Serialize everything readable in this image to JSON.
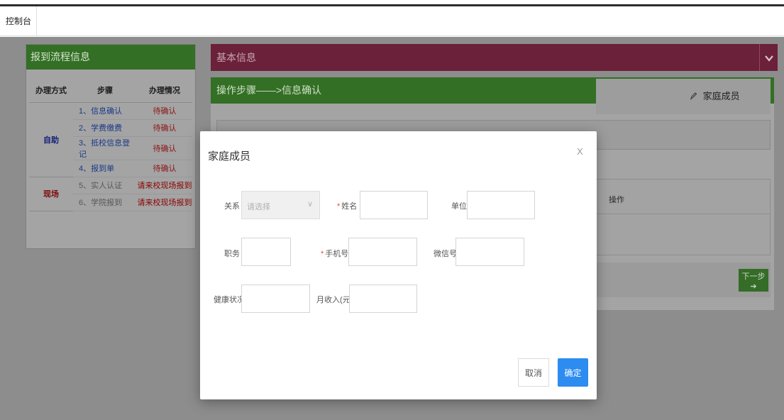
{
  "tabs": [
    {
      "label": "控制台"
    }
  ],
  "left_panel": {
    "title": "报到流程信息",
    "columns": [
      "办理方式",
      "步骤",
      "办理情况"
    ],
    "groups": [
      {
        "mode": "自助",
        "rows": [
          {
            "step": "1、信息确认",
            "status": "待确认"
          },
          {
            "step": "2、学费缴费",
            "status": "待确认"
          },
          {
            "step": "3、抵校信息登记",
            "status": "待确认"
          },
          {
            "step": "4、报到单",
            "status": "待确认"
          }
        ]
      },
      {
        "mode": "现场",
        "rows": [
          {
            "step": "5、实人认证",
            "status": "请来校现场报到"
          },
          {
            "step": "6、学院报到",
            "status": "请来校现场报到"
          }
        ]
      }
    ]
  },
  "basic_info": {
    "title": "基本信息",
    "collapse_icon": "chevron-down-icon"
  },
  "steps_panel": {
    "title": "操作步骤——>信息确认",
    "current_step": "家庭成员",
    "current_step_icon": "pencil-icon",
    "ops_header": "操作",
    "next_button": "下一步"
  },
  "modal": {
    "title": "家庭成员",
    "close": "X",
    "fields": {
      "relation": {
        "label": "关系",
        "placeholder": "请选择"
      },
      "name": {
        "label": "姓名",
        "required": "*"
      },
      "unit": {
        "label": "单位"
      },
      "position": {
        "label": "职务"
      },
      "phone": {
        "label": "手机号",
        "required": "*"
      },
      "wechat": {
        "label": "微信号"
      },
      "health": {
        "label": "健康状况"
      },
      "income": {
        "label": "月收入(元)"
      }
    },
    "cancel": "取消",
    "confirm": "确定"
  },
  "colors": {
    "green_header": "#336f24",
    "maroon_header": "#6b213a",
    "primary_button": "#2d8cf0",
    "overlay": "#8d8d8d"
  }
}
